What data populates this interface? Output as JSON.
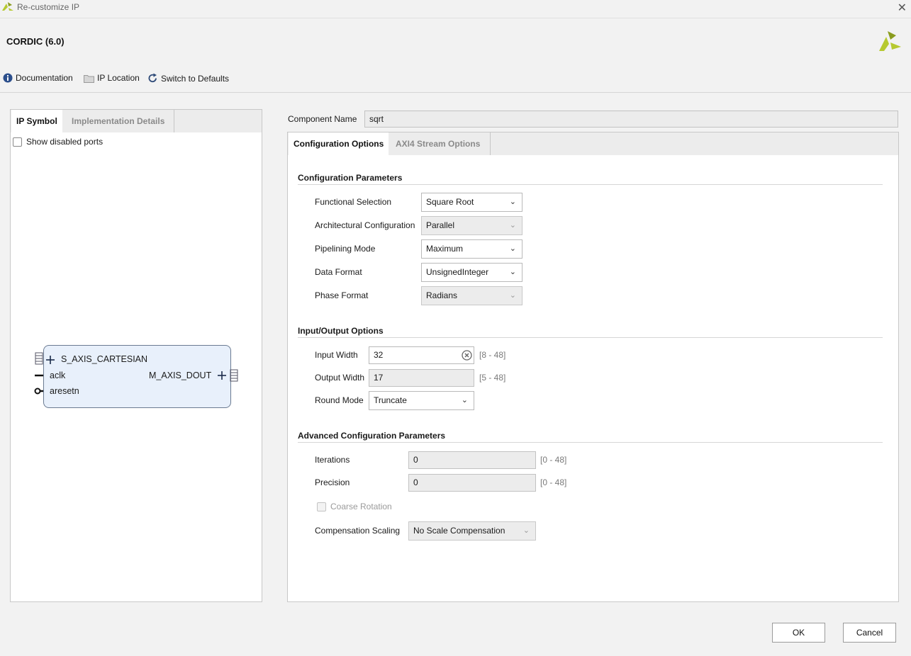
{
  "window": {
    "title": "Re-customize IP",
    "close_glyph": "✕"
  },
  "header": {
    "ip_name": "CORDIC (6.0)"
  },
  "toolbar": {
    "documentation": "Documentation",
    "ip_location": "IP Location",
    "switch_defaults": "Switch to Defaults"
  },
  "left": {
    "tabs": [
      "IP Symbol",
      "Implementation Details"
    ],
    "show_disabled_ports": "Show disabled ports",
    "symbol": {
      "in_bus": "S_AXIS_CARTESIAN",
      "clk": "aclk",
      "reset": "aresetn",
      "out_bus": "M_AXIS_DOUT"
    }
  },
  "component": {
    "label": "Component Name",
    "value": "sqrt"
  },
  "right": {
    "tabs": [
      "Configuration Options",
      "AXI4 Stream Options"
    ],
    "config": {
      "title": "Configuration Parameters",
      "functional_selection": {
        "label": "Functional Selection",
        "value": "Square Root"
      },
      "arch_config": {
        "label": "Architectural Configuration",
        "value": "Parallel"
      },
      "pipelining": {
        "label": "Pipelining Mode",
        "value": "Maximum"
      },
      "data_format": {
        "label": "Data Format",
        "value": "UnsignedInteger"
      },
      "phase_format": {
        "label": "Phase Format",
        "value": "Radians"
      }
    },
    "io": {
      "title": "Input/Output Options",
      "input_width": {
        "label": "Input Width",
        "value": "32",
        "range": "[8 - 48]"
      },
      "output_width": {
        "label": "Output Width",
        "value": "17",
        "range": "[5 - 48]"
      },
      "round_mode": {
        "label": "Round Mode",
        "value": "Truncate"
      }
    },
    "advanced": {
      "title": "Advanced Configuration Parameters",
      "iterations": {
        "label": "Iterations",
        "value": "0",
        "range": "[0 - 48]"
      },
      "precision": {
        "label": "Precision",
        "value": "0",
        "range": "[0 - 48]"
      },
      "coarse_rotation": "Coarse Rotation",
      "compensation": {
        "label": "Compensation Scaling",
        "value": "No Scale Compensation"
      }
    }
  },
  "buttons": {
    "ok": "OK",
    "cancel": "Cancel"
  },
  "colors": {
    "info_blue": "#2c4f8c",
    "logo_green": "#b6c930",
    "logo_dark": "#8a9c1e"
  }
}
